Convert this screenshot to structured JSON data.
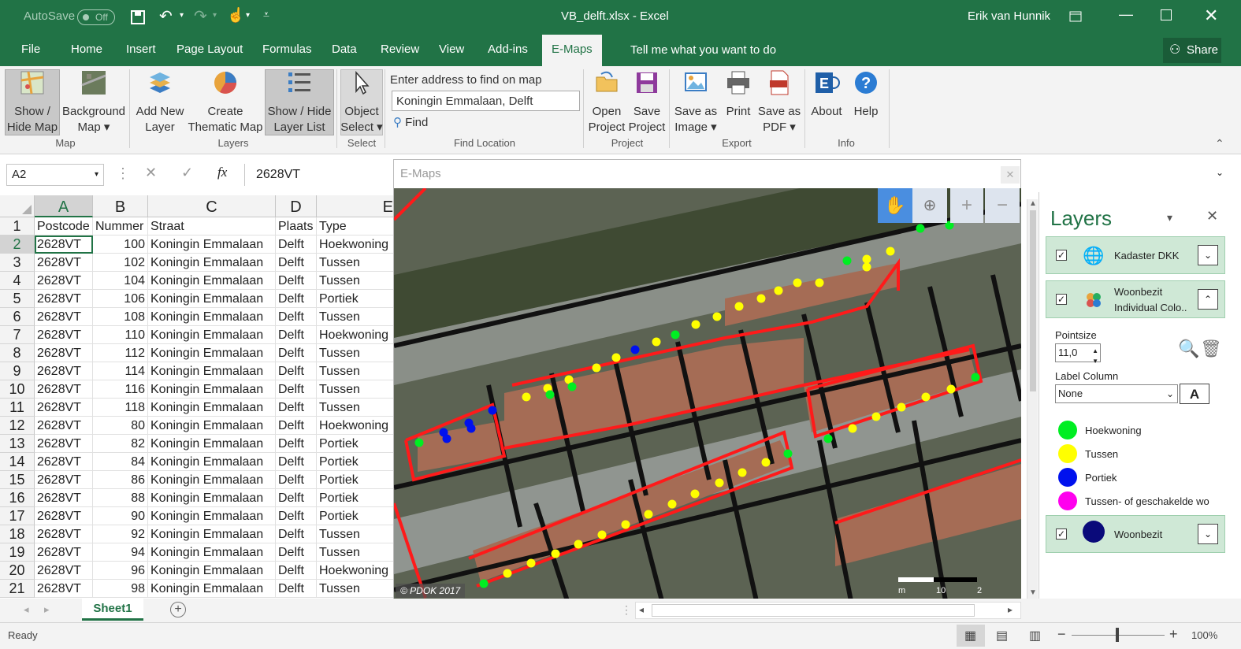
{
  "titlebar": {
    "autosave": "AutoSave",
    "autosave_state": "Off",
    "doc_title": "VB_delft.xlsx  -  Excel",
    "user": "Erik van Hunnik"
  },
  "tabs": [
    {
      "label": "File"
    },
    {
      "label": "Home"
    },
    {
      "label": "Insert"
    },
    {
      "label": "Page Layout"
    },
    {
      "label": "Formulas"
    },
    {
      "label": "Data"
    },
    {
      "label": "Review"
    },
    {
      "label": "View"
    },
    {
      "label": "Add-ins"
    },
    {
      "label": "E-Maps"
    }
  ],
  "tell_me": "Tell me what you want to do",
  "share": "Share",
  "ribbon": {
    "show_hide_map_1": "Show /",
    "show_hide_map_2": "Hide Map",
    "background_map_1": "Background",
    "background_map_2": "Map ▾",
    "group_map": "Map",
    "add_new_layer_1": "Add New",
    "add_new_layer_2": "Layer",
    "create_thematic_1": "Create",
    "create_thematic_2": "Thematic Map",
    "show_hide_layer_1": "Show / Hide",
    "show_hide_layer_2": "Layer List",
    "group_layers": "Layers",
    "object_select_1": "Object",
    "object_select_2": "Select ▾",
    "group_select": "Select",
    "address_label": "Enter address to find on map",
    "address_value": "Koningin Emmalaan, Delft",
    "find": "Find",
    "group_find": "Find Location",
    "open_project_1": "Open",
    "open_project_2": "Project",
    "save_project_1": "Save",
    "save_project_2": "Project",
    "group_project": "Project",
    "save_image_1": "Save as",
    "save_image_2": "Image ▾",
    "print": "Print",
    "save_pdf_1": "Save as",
    "save_pdf_2": "PDF ▾",
    "group_export": "Export",
    "about": "About",
    "help": "Help",
    "group_info": "Info"
  },
  "formula_bar": {
    "name_box": "A2",
    "fx": "fx",
    "value": "2628VT"
  },
  "sheet": {
    "columns": [
      "A",
      "B",
      "C",
      "D",
      "E"
    ],
    "rows": [
      {
        "n": "1",
        "a": "Postcode",
        "b": "Nummer",
        "c": "Straat",
        "d": "Plaats",
        "e": "Type"
      },
      {
        "n": "2",
        "a": "2628VT",
        "b": "100",
        "c": "Koningin Emmalaan",
        "d": "Delft",
        "e": "Hoekwoning"
      },
      {
        "n": "3",
        "a": "2628VT",
        "b": "102",
        "c": "Koningin Emmalaan",
        "d": "Delft",
        "e": "Tussen"
      },
      {
        "n": "4",
        "a": "2628VT",
        "b": "104",
        "c": "Koningin Emmalaan",
        "d": "Delft",
        "e": "Tussen"
      },
      {
        "n": "5",
        "a": "2628VT",
        "b": "106",
        "c": "Koningin Emmalaan",
        "d": "Delft",
        "e": "Portiek"
      },
      {
        "n": "6",
        "a": "2628VT",
        "b": "108",
        "c": "Koningin Emmalaan",
        "d": "Delft",
        "e": "Tussen"
      },
      {
        "n": "7",
        "a": "2628VT",
        "b": "110",
        "c": "Koningin Emmalaan",
        "d": "Delft",
        "e": "Hoekwoning"
      },
      {
        "n": "8",
        "a": "2628VT",
        "b": "112",
        "c": "Koningin Emmalaan",
        "d": "Delft",
        "e": "Tussen"
      },
      {
        "n": "9",
        "a": "2628VT",
        "b": "114",
        "c": "Koningin Emmalaan",
        "d": "Delft",
        "e": "Tussen"
      },
      {
        "n": "10",
        "a": "2628VT",
        "b": "116",
        "c": "Koningin Emmalaan",
        "d": "Delft",
        "e": "Tussen"
      },
      {
        "n": "11",
        "a": "2628VT",
        "b": "118",
        "c": "Koningin Emmalaan",
        "d": "Delft",
        "e": "Tussen"
      },
      {
        "n": "12",
        "a": "2628VT",
        "b": "80",
        "c": "Koningin Emmalaan",
        "d": "Delft",
        "e": "Hoekwoning"
      },
      {
        "n": "13",
        "a": "2628VT",
        "b": "82",
        "c": "Koningin Emmalaan",
        "d": "Delft",
        "e": "Portiek"
      },
      {
        "n": "14",
        "a": "2628VT",
        "b": "84",
        "c": "Koningin Emmalaan",
        "d": "Delft",
        "e": "Portiek"
      },
      {
        "n": "15",
        "a": "2628VT",
        "b": "86",
        "c": "Koningin Emmalaan",
        "d": "Delft",
        "e": "Portiek"
      },
      {
        "n": "16",
        "a": "2628VT",
        "b": "88",
        "c": "Koningin Emmalaan",
        "d": "Delft",
        "e": "Portiek"
      },
      {
        "n": "17",
        "a": "2628VT",
        "b": "90",
        "c": "Koningin Emmalaan",
        "d": "Delft",
        "e": "Portiek"
      },
      {
        "n": "18",
        "a": "2628VT",
        "b": "92",
        "c": "Koningin Emmalaan",
        "d": "Delft",
        "e": "Tussen"
      },
      {
        "n": "19",
        "a": "2628VT",
        "b": "94",
        "c": "Koningin Emmalaan",
        "d": "Delft",
        "e": "Tussen"
      },
      {
        "n": "20",
        "a": "2628VT",
        "b": "96",
        "c": "Koningin Emmalaan",
        "d": "Delft",
        "e": "Hoekwoning"
      },
      {
        "n": "21",
        "a": "2628VT",
        "b": "98",
        "c": "Koningin Emmalaan",
        "d": "Delft",
        "e": "Tussen"
      }
    ]
  },
  "map_window": {
    "title": "E-Maps",
    "copyright": "© PDOK  2017",
    "scale_labels": [
      "m",
      "10",
      "2"
    ]
  },
  "layers_panel": {
    "title": "Layers",
    "layer1": "Kadaster DKK",
    "layer2_line1": "Woonbezit",
    "layer2_line2": "Individual Colo..",
    "pointsize_label": "Pointsize",
    "pointsize_value": "11,0",
    "label_column_label": "Label Column",
    "label_column_value": "None",
    "legend": [
      {
        "label": "Hoekwoning",
        "color": "#00ee22"
      },
      {
        "label": "Tussen",
        "color": "#ffff00"
      },
      {
        "label": "Portiek",
        "color": "#0011ee"
      },
      {
        "label": "Tussen- of geschakelde wo",
        "color": "#ff00ee"
      }
    ],
    "layer3": "Woonbezit"
  },
  "sheet_tab": "Sheet1",
  "status": {
    "ready": "Ready",
    "zoom": "100%"
  }
}
